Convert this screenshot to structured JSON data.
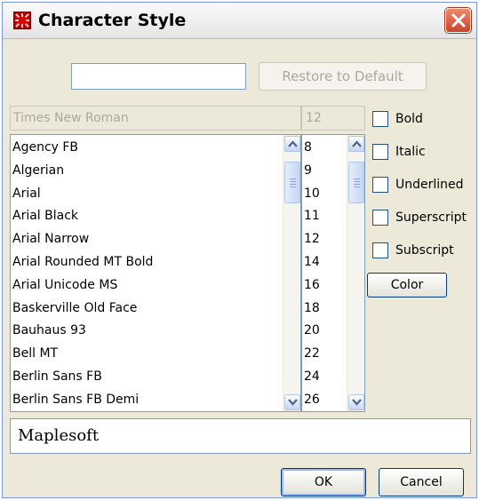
{
  "window": {
    "title": "Character Style",
    "app_icon": "red-square-icon",
    "close_icon": "close-icon"
  },
  "top": {
    "input_value": "",
    "restore_label": "Restore to Default"
  },
  "font_field": {
    "value": "Times New Roman"
  },
  "size_field": {
    "value": "12"
  },
  "fonts": [
    "Agency FB",
    "Algerian",
    "Arial",
    "Arial Black",
    "Arial Narrow",
    "Arial Rounded MT Bold",
    "Arial Unicode MS",
    "Baskerville Old Face",
    "Bauhaus 93",
    "Bell MT",
    "Berlin Sans FB",
    "Berlin Sans FB Demi"
  ],
  "sizes": [
    "8",
    "9",
    "10",
    "11",
    "12",
    "14",
    "16",
    "18",
    "20",
    "22",
    "24",
    "26"
  ],
  "checkboxes": [
    {
      "label": "Bold",
      "checked": false
    },
    {
      "label": "Italic",
      "checked": false
    },
    {
      "label": "Underlined",
      "checked": false
    },
    {
      "label": "Superscript",
      "checked": false
    },
    {
      "label": "Subscript",
      "checked": false
    }
  ],
  "color_label": "Color",
  "preview": {
    "value": "Maplesoft"
  },
  "buttons": {
    "ok": "OK",
    "cancel": "Cancel"
  }
}
